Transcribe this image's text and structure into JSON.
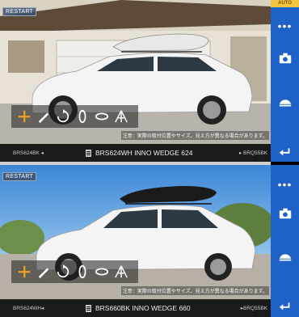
{
  "top": {
    "restart_label": "RESTART",
    "notice": "注意：実際の取付位置やサイズ、見え方が異なる場合があります。",
    "prev_label": "BRS624BK ◂",
    "title": "BRS624WH  INNO WEDGE 624",
    "next_label": "▸ BRQ55BK"
  },
  "bottom": {
    "restart_label": "RESTART",
    "notice": "注意：実際の取付位置やサイズ、見え方が異なる場合があります。",
    "prev_label": "BRS624WH◂",
    "title": "BRS660BK  INNO WEDGE 660",
    "next_label": "▸BRQ55BK"
  },
  "sidebar": {
    "auto_label": "AUTO",
    "menu_glyph": "•••"
  },
  "colors": {
    "accent_blue": "#1e62c8",
    "auto_yellow": "#f4c542",
    "plus_orange": "#f0a020",
    "car_white": "#f4f4f4"
  },
  "icons": [
    "plus-icon",
    "pen-icon",
    "rotate-icon",
    "spin-icon",
    "orbit-icon",
    "perspective-icon",
    "more-icon",
    "camera-icon",
    "carrier-icon",
    "back-icon"
  ]
}
